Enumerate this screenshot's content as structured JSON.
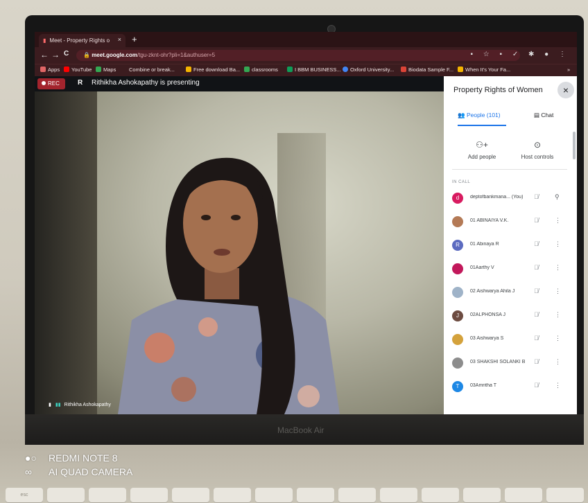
{
  "browser": {
    "tab_title": "Meet - Property Rights o",
    "tab_close": "×",
    "new_tab": "+",
    "back": "←",
    "forward": "→",
    "reload": "C",
    "url_host": "meet.google.com",
    "url_path": "/tgu-zknt-ohr?pli=1&authuser=5",
    "extensions": "▪ ☆ ▪ ✓ ✱ ●  ⋮"
  },
  "bookmarks": [
    {
      "label": "Apps",
      "color": "#e06666"
    },
    {
      "label": "YouTube",
      "color": "#ff0000"
    },
    {
      "label": "Maps",
      "color": "#34a853"
    },
    {
      "label": "Combine or break...",
      "color": "#f4b400"
    },
    {
      "label": "Free download Ba...",
      "color": "#f4b400"
    },
    {
      "label": "classrooms",
      "color": "#34a853"
    },
    {
      "label": "I BBM BUSINESS...",
      "color": "#0f9d58"
    },
    {
      "label": "Oxford University...",
      "color": "#4285f4"
    },
    {
      "label": "Biodata Sample F...",
      "color": "#db4437"
    },
    {
      "label": "When It's Your Fa...",
      "color": "#f4b400"
    }
  ],
  "meet": {
    "rec_label": "REC",
    "presenter_initial": "R",
    "presenting_text": "Rithikha Ashokapathy is presenting",
    "video_name": "Rithikha Ashokapathy"
  },
  "panel": {
    "title": "Property Rights of Women",
    "close": "×",
    "tab_people": "People (101)",
    "tab_chat": "Chat",
    "add_people": "Add people",
    "host_controls": "Host controls",
    "in_call": "IN CALL",
    "participants": [
      {
        "initial": "d",
        "name": "deptofbankmana... (You)",
        "color": "#d81b60",
        "mic": "🎙",
        "more": "⚲"
      },
      {
        "initial": "",
        "name": "01 ABINAIYA V.K.",
        "color": "#b47a56",
        "mic": "🎙",
        "more": "⋮"
      },
      {
        "initial": "R",
        "name": "01 Abinaya R",
        "color": "#5c6bc0",
        "mic": "🎙",
        "more": "⋮"
      },
      {
        "initial": "",
        "name": "01Aarthy V",
        "color": "#c2185b",
        "mic": "🎙",
        "more": "⋮"
      },
      {
        "initial": "",
        "name": "02 Aishwarya Ahila J",
        "color": "#9fb3c8",
        "mic": "🎙",
        "more": "⋮"
      },
      {
        "initial": "J",
        "name": "02ALPHONSA J",
        "color": "#6d4c41",
        "mic": "🎙",
        "more": "⋮"
      },
      {
        "initial": "",
        "name": "03 Aishwarya S",
        "color": "#d4a23c",
        "mic": "🎙",
        "more": "⋮"
      },
      {
        "initial": "",
        "name": "03 SHAKSHI SOLANKI B",
        "color": "#8d8d8d",
        "mic": "🎙",
        "more": "⋮"
      },
      {
        "initial": "T",
        "name": "03Amritha T",
        "color": "#1e88e5",
        "mic": "🎙",
        "more": "⋮"
      }
    ]
  },
  "laptop": {
    "brand": "MacBook Air"
  },
  "watermark": {
    "line1": "REDMI NOTE 8",
    "line2": "AI QUAD CAMERA"
  },
  "keys": [
    "esc",
    "",
    "",
    "",
    "",
    "",
    "",
    "",
    "",
    "",
    "",
    "",
    "",
    ""
  ]
}
